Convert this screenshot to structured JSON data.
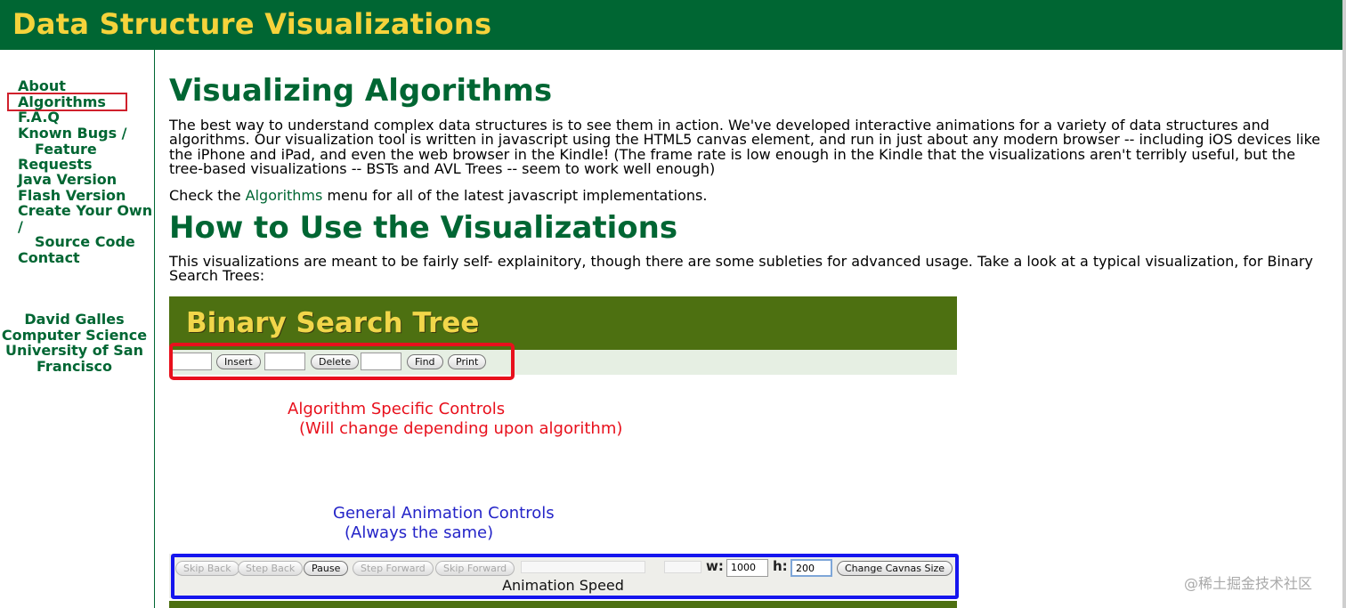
{
  "header": {
    "title": "Data Structure Visualizations"
  },
  "sidebar": {
    "nav": [
      {
        "label": "About"
      },
      {
        "label": "Algorithms"
      },
      {
        "label": "F.A.Q"
      },
      {
        "label": "Known Bugs /",
        "continuation": "Feature",
        "continuation2": "Requests"
      },
      {
        "label": "Java Version"
      },
      {
        "label": "Flash Version"
      },
      {
        "label": "Create Your Own",
        "continuation": "/",
        "continuation2": "Source Code"
      },
      {
        "label": "Contact"
      }
    ],
    "author": {
      "line1": "David Galles",
      "line2": "Computer Science",
      "line3": "University of San",
      "line4": "Francisco"
    }
  },
  "main": {
    "heading1": "Visualizing Algorithms",
    "intro": "The best way to understand complex data structures is to see them in action. We've developed interactive animations for a variety of data structures and algorithms. Our visualization tool is written in javascript using the HTML5 canvas element, and run in just about any modern browser -- including iOS devices like the iPhone and iPad, and even the web browser in the Kindle! (The frame rate is low enough in the Kindle that the visualizations aren't terribly useful, but the tree-based visualizations -- BSTs and AVL Trees -- seem to work well enough)",
    "check_prefix": "Check the ",
    "check_link": "Algorithms",
    "check_suffix": " menu for all of the latest javascript implementations.",
    "heading2": "How to Use the Visualizations",
    "howto": "This visualizations are meant to be fairly self- explainitory, though there are some subleties for advanced usage. Take a look at a typical visualization, for Binary Search Trees:"
  },
  "figure": {
    "title": "Binary Search Tree",
    "algo_buttons": {
      "insert": "Insert",
      "delete": "Delete",
      "find": "Find",
      "print": "Print"
    },
    "algo_note": {
      "line1": "Algorithm Specific Controls",
      "line2": "(Will change depending upon algorithm)"
    },
    "general_note": {
      "line1": "General Animation Controls",
      "line2": "(Always the same)"
    },
    "anim_buttons": {
      "skip_back": "Skip Back",
      "step_back": "Step Back",
      "pause": "Pause",
      "step_forward": "Step Forward",
      "skip_forward": "Skip Forward",
      "change_size": "Change Cavnas Size"
    },
    "width_label": "w:",
    "width_value": "1000",
    "height_label": "h:",
    "height_value": "200",
    "speed_label": "Animation Speed"
  },
  "watermark": "@稀土掘金技术社区",
  "colors": {
    "header_bg": "#006633",
    "header_text": "#f5d33b",
    "link": "#006633",
    "highlight": "#d0202c"
  }
}
